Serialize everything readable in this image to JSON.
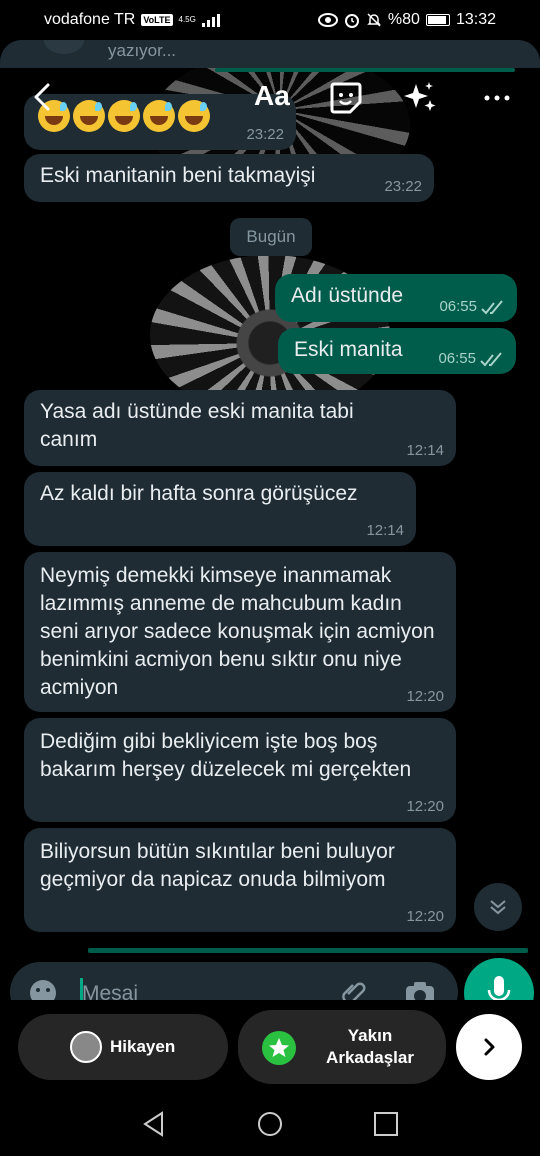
{
  "status_bar": {
    "carrier": "vodafone TR",
    "volte": "VoLTE",
    "network": "4.5G",
    "battery": "%80",
    "time": "13:32"
  },
  "header": {
    "typing": "yazıyor..."
  },
  "editor_toolbar": {
    "text_tool": "Aa"
  },
  "messages": [
    {
      "direction": "in",
      "emoji": [
        "😅",
        "😅",
        "😅",
        "😅",
        "😅"
      ],
      "time": "23:22"
    },
    {
      "direction": "in",
      "text": "Eski manitanin beni takmayişi",
      "time": "23:22"
    },
    {
      "direction": "out",
      "text": "Adı üstünde",
      "time": "06:55",
      "status": "read"
    },
    {
      "direction": "out",
      "text": "Eski manita",
      "time": "06:55",
      "status": "read"
    },
    {
      "direction": "in",
      "text": "Yasa adı üstünde eski manita tabi canım",
      "time": "12:14"
    },
    {
      "direction": "in",
      "text": "Az kaldı bir hafta sonra görüşücez",
      "time": "12:14"
    },
    {
      "direction": "in",
      "text": "Neymiş demekki kimseye inanmamak lazımmış anneme de mahcubum kadın seni arıyor sadece konuşmak için acmiyon benimkini acmiyon benu sıktır onu niye acmiyon",
      "time": "12:20"
    },
    {
      "direction": "in",
      "text": "Dediğim gibi bekliyicem işte boş boş bakarım herşey düzelecek mi gerçekten",
      "time": "12:20"
    },
    {
      "direction": "in",
      "text": "Biliyorsun bütün sıkıntılar beni buluyor geçmiyor da napicaz onuda bilmiyom",
      "time": "12:20"
    }
  ],
  "day_divider": "Bugün",
  "composer": {
    "placeholder": "Mesaj"
  },
  "share_bar": {
    "story_label": "Hikayen",
    "close_friends_label": "Yakın Arkadaşlar"
  },
  "colors": {
    "incoming_bubble": "#1f2c34",
    "outgoing_bubble": "#005c4b",
    "accent": "#00a884"
  }
}
